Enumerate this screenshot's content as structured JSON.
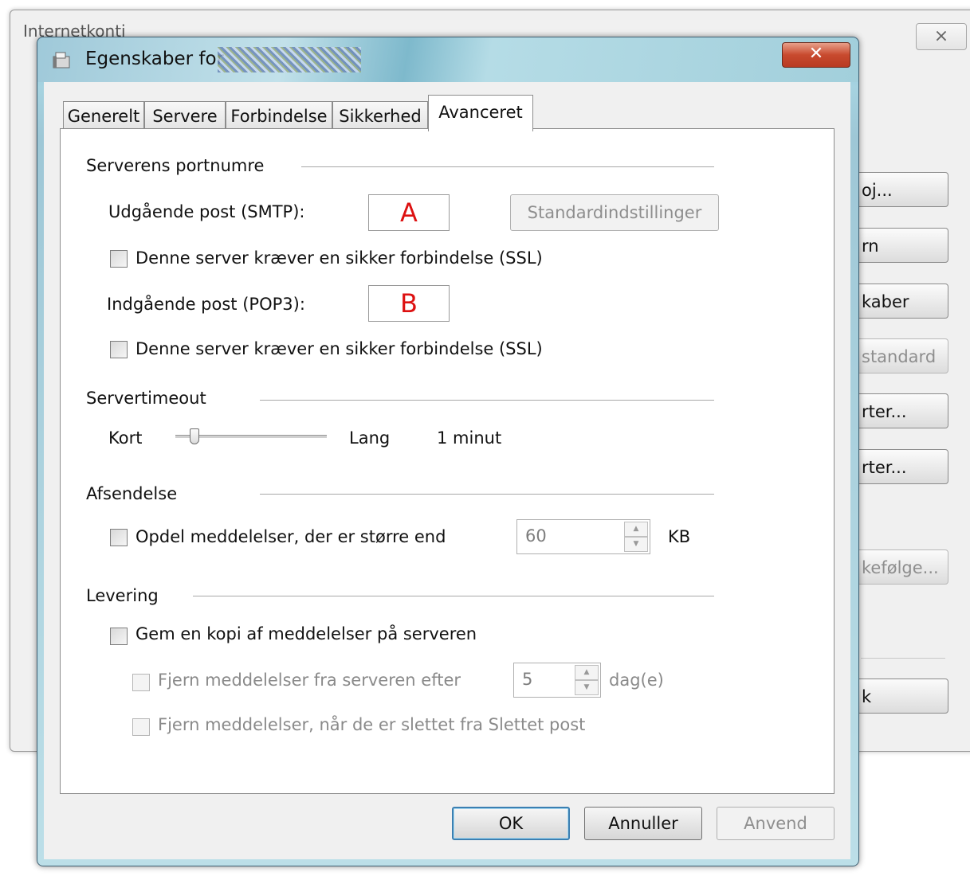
{
  "background_window": {
    "title": "Internetkonti",
    "close_glyph": "⨯",
    "buttons": [
      "oj...",
      "rn",
      "kaber",
      "standard",
      "rter...",
      "rter...",
      "kefølge...",
      "k"
    ]
  },
  "dialog": {
    "title": "Egenskaber for",
    "close_glyph": "✕",
    "tabs": [
      "Generelt",
      "Servere",
      "Forbindelse",
      "Sikkerhed",
      "Avanceret"
    ],
    "active_tab": "Avanceret",
    "ports": {
      "group_label": "Serverens portnumre",
      "smtp_label": "Udgående post (SMTP):",
      "smtp_value": "A",
      "defaults_button": "Standardindstillinger",
      "smtp_ssl_label": "Denne server kræver en sikker forbindelse (SSL)",
      "pop3_label": "Indgående post (POP3):",
      "pop3_value": "B",
      "pop3_ssl_label": "Denne server kræver en sikker forbindelse (SSL)"
    },
    "timeout": {
      "group_label": "Servertimeout",
      "short_label": "Kort",
      "long_label": "Lang",
      "value_text": "1 minut",
      "slider_fraction": 0.1
    },
    "sending": {
      "group_label": "Afsendelse",
      "split_label": "Opdel meddelelser, der er større end",
      "split_value": "60",
      "unit": "KB"
    },
    "delivery": {
      "group_label": "Levering",
      "keep_copy_label": "Gem en kopi af meddelelser på serveren",
      "remove_after_label": "Fjern meddelelser fra serveren efter",
      "remove_after_value": "5",
      "days_unit": "dag(e)",
      "remove_deleted_label": "Fjern meddelelser, når de er slettet fra Slettet post"
    },
    "footer": {
      "ok": "OK",
      "cancel": "Annuller",
      "apply": "Anvend"
    }
  }
}
